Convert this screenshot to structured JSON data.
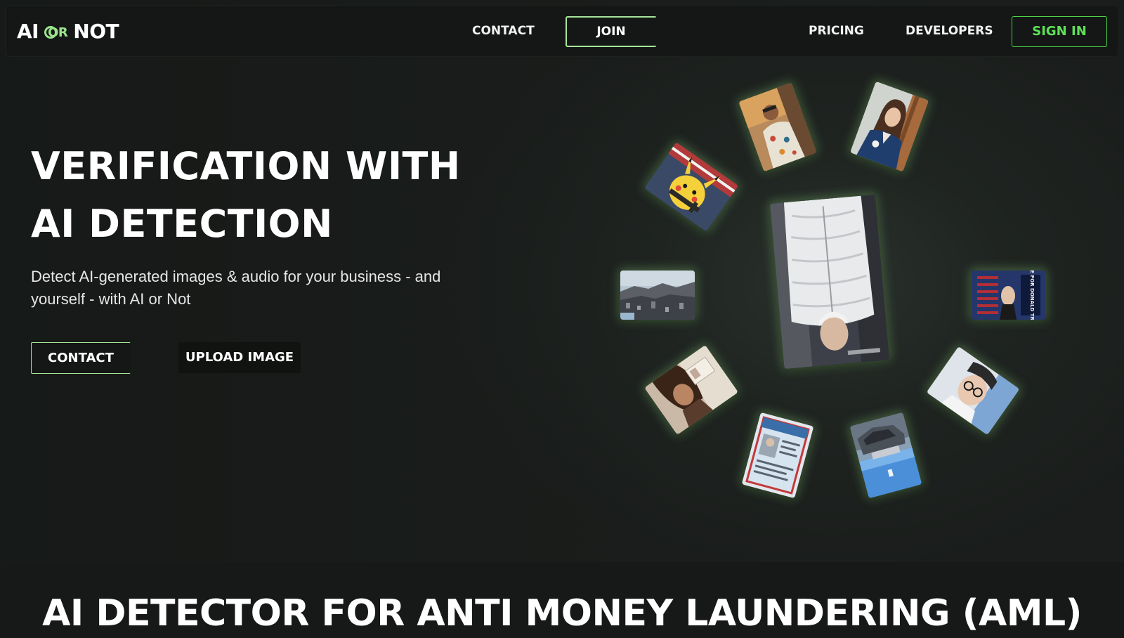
{
  "header": {
    "logo": {
      "left": "AI",
      "middle": "OR",
      "right": "NOT"
    },
    "nav": {
      "contact_label": "CONTACT",
      "join_label": "JOIN",
      "pricing_label": "PRICING",
      "developers_label": "DEVELOPERS",
      "signin_label": "SIGN IN"
    }
  },
  "hero": {
    "title_line1": "VERIFICATION WITH",
    "title_line2": "AI DETECTION",
    "subtitle": "Detect AI-generated images & audio for your business - and yourself - with AI or Not",
    "contact_button": "CONTACT",
    "upload_button": "UPLOAD IMAGE",
    "gallery": [
      {
        "name": "man-in-floral-shirt-photo"
      },
      {
        "name": "woman-in-blue-blazer-photo"
      },
      {
        "name": "pikachu-with-gun-image"
      },
      {
        "name": "man-in-white-puffer-jacket-photo"
      },
      {
        "name": "city-aerial-photo"
      },
      {
        "name": "political-poster-image",
        "text": "VOTE FOR DONALD TRUMP"
      },
      {
        "name": "woman-holding-id-photo"
      },
      {
        "name": "id-card-image"
      },
      {
        "name": "car-crash-photo"
      },
      {
        "name": "man-with-glasses-photo"
      }
    ]
  },
  "section": {
    "title": "AI DETECTOR FOR ANTI MONEY LAUNDERING (AML)"
  },
  "colors": {
    "accent": "#5ee057",
    "accent_soft": "#a8e59a",
    "background": "#161917"
  }
}
